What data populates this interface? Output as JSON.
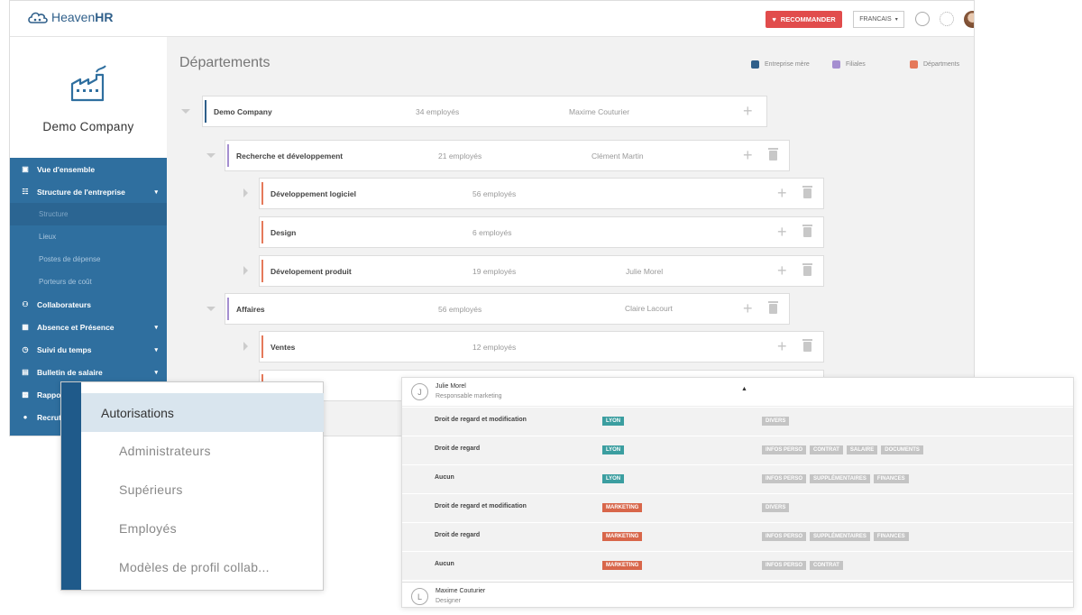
{
  "header": {
    "logo_text_light": "Heaven",
    "logo_text_bold": "HR",
    "recommend_label": "RECOMMANDER",
    "language_label": "FRANCAIS",
    "icons": [
      "phone-icon",
      "gear-icon",
      "avatar"
    ]
  },
  "sidebar": {
    "company_name": "Demo Company",
    "items": [
      {
        "label": "Vue d'ensemble",
        "icon": "dashboard-icon"
      },
      {
        "label": "Structure de l'entreprise",
        "icon": "org-chart-icon",
        "expanded": true
      },
      {
        "label": "Structure",
        "sub": true,
        "active": true
      },
      {
        "label": "Lieux",
        "sub": true
      },
      {
        "label": "Postes de dépense",
        "sub": true
      },
      {
        "label": "Porteurs de coût",
        "sub": true
      },
      {
        "label": "Collaborateurs",
        "icon": "people-icon"
      },
      {
        "label": "Absence et Présence",
        "icon": "calendar-icon"
      },
      {
        "label": "Suivi du temps",
        "icon": "clock-icon"
      },
      {
        "label": "Bulletin de salaire",
        "icon": "document-icon"
      },
      {
        "label": "Rappo",
        "icon": "chart-icon"
      },
      {
        "label": "Recrut",
        "icon": "briefcase-icon"
      }
    ]
  },
  "main": {
    "title": "Départements",
    "legend": [
      {
        "label": "Entreprise mère",
        "color": "#2f5f8a"
      },
      {
        "label": "Filiales",
        "color": "#a58fd0"
      },
      {
        "label": "Départments",
        "color": "#e5795a"
      }
    ],
    "rows": [
      {
        "name": "Demo Company",
        "count": "34 employés",
        "manager": "Maxime Couturier"
      },
      {
        "name": "Recherche et développement",
        "count": "21 employés",
        "manager": "Clément Martin"
      },
      {
        "name": "Développement logiciel",
        "count": "56 employés",
        "manager": ""
      },
      {
        "name": "Design",
        "count": "6 employés",
        "manager": ""
      },
      {
        "name": "Dévelopement produit",
        "count": "19 employés",
        "manager": "Julie Morel"
      },
      {
        "name": "Affaires",
        "count": "56 employés",
        "manager": "Claire Lacourt"
      },
      {
        "name": "Ventes",
        "count": "12 employés",
        "manager": ""
      }
    ]
  },
  "authorizations": {
    "title": "Autorisations",
    "items": [
      "Administrateurs",
      "Supérieurs",
      "Employés",
      "Modèles de profil collab..."
    ]
  },
  "permissions": {
    "users": [
      {
        "initial": "J",
        "name": "Julie Morel",
        "role": "Responsable marketing"
      },
      {
        "initial": "L",
        "name": "Maxime Couturier",
        "role": "Designer"
      }
    ],
    "rows": [
      {
        "label": "Droit de regard et modification",
        "scope": "LYON",
        "chips": [
          "DIVERS"
        ]
      },
      {
        "label": "Droit de regard",
        "scope": "LYON",
        "chips": [
          "INFOS PERSO",
          "CONTRAT",
          "SALAIRE",
          "DOCUMENTS"
        ]
      },
      {
        "label": "Aucun",
        "scope": "LYON",
        "chips": [
          "INFOS PERSO",
          "SUPPLÉMENTAIRES",
          "FINANCES"
        ]
      },
      {
        "label": "Droit de regard et modification",
        "scope": "MARKETING",
        "chips": [
          "DIVERS"
        ]
      },
      {
        "label": "Droit de regard",
        "scope": "MARKETING",
        "chips": [
          "INFOS PERSO",
          "SUPPLÉMENTAIRES",
          "FINANCES"
        ]
      },
      {
        "label": "Aucun",
        "scope": "MARKETING",
        "chips": [
          "INFOS PERSO",
          "CONTRAT"
        ]
      }
    ]
  }
}
